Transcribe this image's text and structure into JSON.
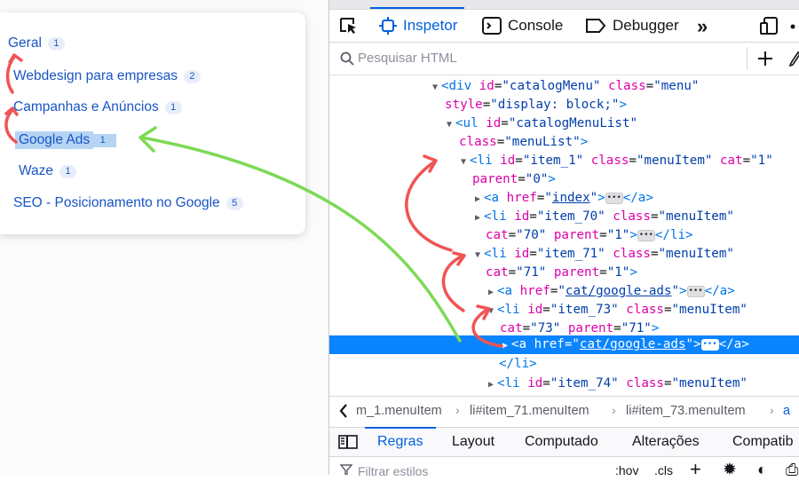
{
  "menu": {
    "items": [
      {
        "label": "Geral",
        "count": "1"
      },
      {
        "label": "Webdesign para empresas",
        "count": "2"
      },
      {
        "label": "Campanhas e Anúncios",
        "count": "1"
      },
      {
        "label": "Google Ads",
        "count": "1"
      },
      {
        "label": "Waze",
        "count": "1"
      },
      {
        "label": "SEO - Posicionamento no Google",
        "count": "5"
      }
    ]
  },
  "devtools": {
    "tabs": {
      "inspector": "Inspetor",
      "console": "Console",
      "debugger": "Debugger"
    },
    "icons": {
      "picker": "element-picker-icon",
      "inspector": "inspector-icon",
      "console": "console-icon",
      "debugger": "debugger-icon",
      "more": "chevron-double-right-icon",
      "responsive": "responsive-design-icon",
      "menu": "more-dots-icon",
      "search": "search-icon",
      "add": "plus-icon",
      "eyedropper": "eyedropper-icon"
    },
    "search_placeholder": "Pesquisar HTML",
    "breadcrumbs": [
      "m_1.menuItem",
      "li#item_71.menuItem",
      "li#item_73.menuItem",
      "a"
    ],
    "rules_tabs": [
      "Regras",
      "Layout",
      "Computado",
      "Alterações",
      "Compatib"
    ],
    "filter": {
      "placeholder": "Filtrar estilos",
      "hov": ":hov",
      "cls": ".cls"
    }
  },
  "markup": {
    "div": {
      "tag": "div",
      "id_attr": "id",
      "id_val": "\"catalogMenu\"",
      "class_attr": "class",
      "class_val": "\"menu\"",
      "style_attr": "style",
      "style_val": "\"display: block;\"",
      "close": ">"
    },
    "ul": {
      "tag": "ul",
      "id_attr": "id",
      "id_val": "\"catalogMenuList\"",
      "class_attr": "class",
      "class_val": "\"menuList\"",
      "close": ">"
    },
    "li1": {
      "tag": "li",
      "id_attr": "id",
      "id_val": "\"item_1\"",
      "class_attr": "class",
      "class_val": "\"menuItem\"",
      "cat_attr": "cat",
      "cat_val": "\"1\"",
      "parent_attr": "parent",
      "parent_val": "\"0\"",
      "close": ">"
    },
    "a_index": {
      "tag": "a",
      "href_attr": "href",
      "href_val": "index",
      "close_tag": "</a>"
    },
    "li70": {
      "tag": "li",
      "id_attr": "id",
      "id_val": "\"item_70\"",
      "class_attr": "class",
      "class_val": "\"menuItem\"",
      "cat_attr": "cat",
      "cat_val": "\"70\"",
      "parent_attr": "parent",
      "parent_val": "\"1\"",
      "close_tag": "</li>"
    },
    "li71": {
      "tag": "li",
      "id_attr": "id",
      "id_val": "\"item_71\"",
      "class_attr": "class",
      "class_val": "\"menuItem\"",
      "cat_attr": "cat",
      "cat_val": "\"71\"",
      "parent_attr": "parent",
      "parent_val": "\"1\"",
      "close": ">"
    },
    "a71": {
      "tag": "a",
      "href_attr": "href",
      "href_val": "cat/google-ads",
      "close_tag": "</a>"
    },
    "li73": {
      "tag": "li",
      "id_attr": "id",
      "id_val": "\"item_73\"",
      "class_attr": "class",
      "class_val": "\"menuItem\"",
      "cat_attr": "cat",
      "cat_val": "\"73\"",
      "parent_attr": "parent",
      "parent_val": "\"71\"",
      "close": ">"
    },
    "a73": {
      "tag": "a",
      "href_attr": "href",
      "href_val": "cat/google-ads",
      "close_tag": "</a>"
    },
    "li_close": "</li>",
    "li74": {
      "tag": "li",
      "id_attr": "id",
      "id_val": "\"item_74\"",
      "class_attr": "class",
      "class_val": "\"menuItem\""
    }
  },
  "colors": {
    "accent": "#0060df",
    "selection": "#0a84ff",
    "tag": "#0074e8",
    "attr_name": "#dd00a9",
    "attr_value": "#003eaa",
    "menu_link": "#1a55c4",
    "annotation_red": "#f05454",
    "annotation_green": "#7ed957"
  }
}
